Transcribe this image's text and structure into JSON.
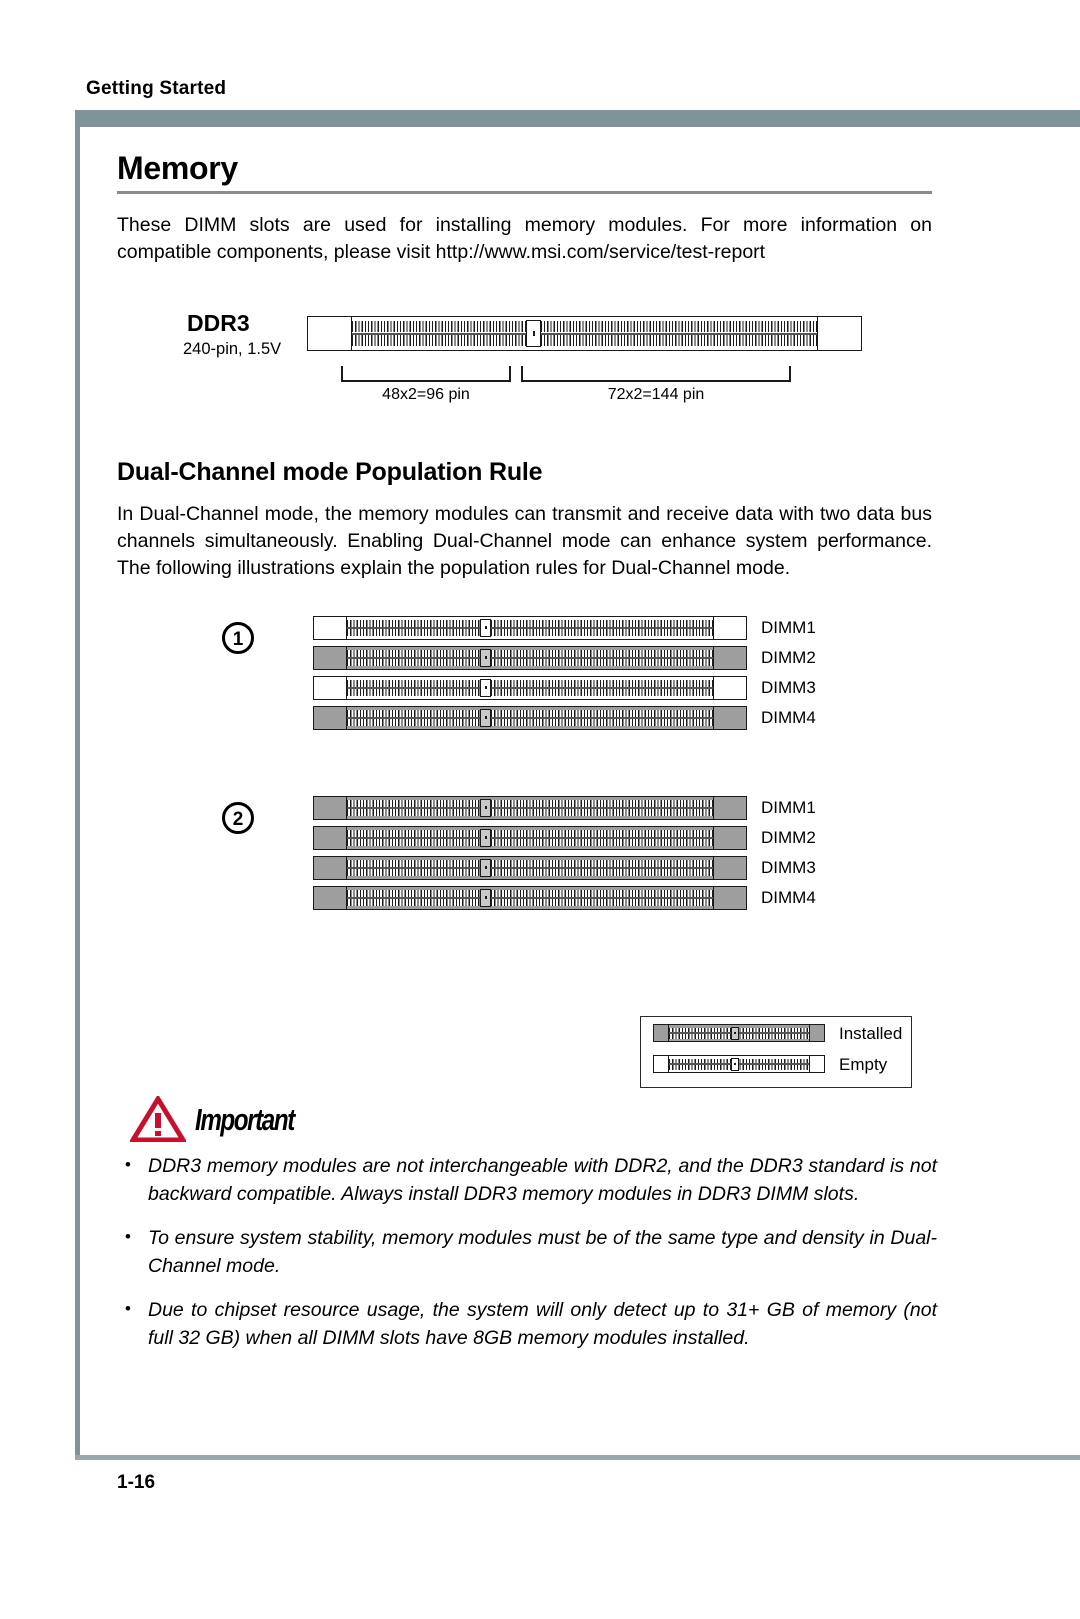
{
  "running_head": "Getting Started",
  "page_number": "1-16",
  "section": {
    "title": "Memory",
    "intro": "These DIMM slots are used for installing memory modules. For more information on compatible components, please visit http://www.msi.com/service/test-report"
  },
  "ddr3_figure": {
    "name": "DDR3",
    "spec": "240-pin, 1.5V",
    "dimension_left": "48x2=96 pin",
    "dimension_right": "72x2=144  pin"
  },
  "dual_channel": {
    "title": "Dual-Channel mode Population Rule",
    "body": "In Dual-Channel mode, the memory modules can transmit and receive data with two data bus channels simultaneously. Enabling Dual-Channel mode can enhance system performance. The following illustrations explain the population rules for Dual-Channel mode.",
    "configurations": [
      {
        "badge": "1",
        "slots": [
          {
            "label": "DIMM1",
            "state": "empty"
          },
          {
            "label": "DIMM2",
            "state": "installed"
          },
          {
            "label": "DIMM3",
            "state": "empty"
          },
          {
            "label": "DIMM4",
            "state": "installed"
          }
        ]
      },
      {
        "badge": "2",
        "slots": [
          {
            "label": "DIMM1",
            "state": "installed"
          },
          {
            "label": "DIMM2",
            "state": "installed"
          },
          {
            "label": "DIMM3",
            "state": "installed"
          },
          {
            "label": "DIMM4",
            "state": "installed"
          }
        ]
      }
    ],
    "legend": [
      {
        "label": "Installed",
        "state": "installed"
      },
      {
        "label": "Empty",
        "state": "empty"
      }
    ]
  },
  "important": {
    "heading": "Important",
    "notes": [
      "DDR3 memory modules are not interchangeable with DDR2, and the DDR3 standard is not backward compatible. Always install DDR3 memory modules in DDR3 DIMM slots.",
      "To ensure system stability, memory modules must be of the same type and density in Dual-Channel mode.",
      "Due to chipset resource usage, the system will only detect up to 31+ GB of memory (not full 32 GB) when all DIMM slots have 8GB memory modules installed."
    ]
  },
  "colors": {
    "frame": "#7e9499",
    "rule": "#8a8a8a",
    "installed_fill": "#9e9e9e",
    "warning_red": "#c8102e"
  }
}
